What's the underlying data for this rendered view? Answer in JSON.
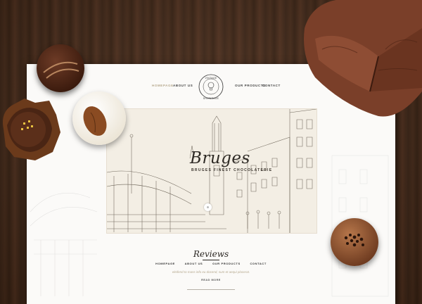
{
  "nav": {
    "left": [
      "HOMEPAGE",
      "ABOUT US"
    ],
    "right": [
      "OUR PRODUCTS",
      "CONTACT"
    ],
    "logo_text_top": "VINTAGE",
    "logo_text_bottom": "SHOWCASE"
  },
  "hero": {
    "title": "Bruges",
    "subtitle": "BRUGES FINEST CHOCOLATERIE"
  },
  "reviews": {
    "title": "Reviews",
    "nav": [
      "HOMEPAGE",
      "ABOUT US",
      "OUR PRODUCTS",
      "CONTACT"
    ],
    "tagline": "eleifend to mass info eu docend, sum et aequi placerat.",
    "cta": "READ MORE"
  },
  "colors": {
    "wood": "#4a2d1b",
    "paper": "#fbfaf8",
    "accent": "#b7a98e",
    "chocolate": "#6b3a24"
  }
}
